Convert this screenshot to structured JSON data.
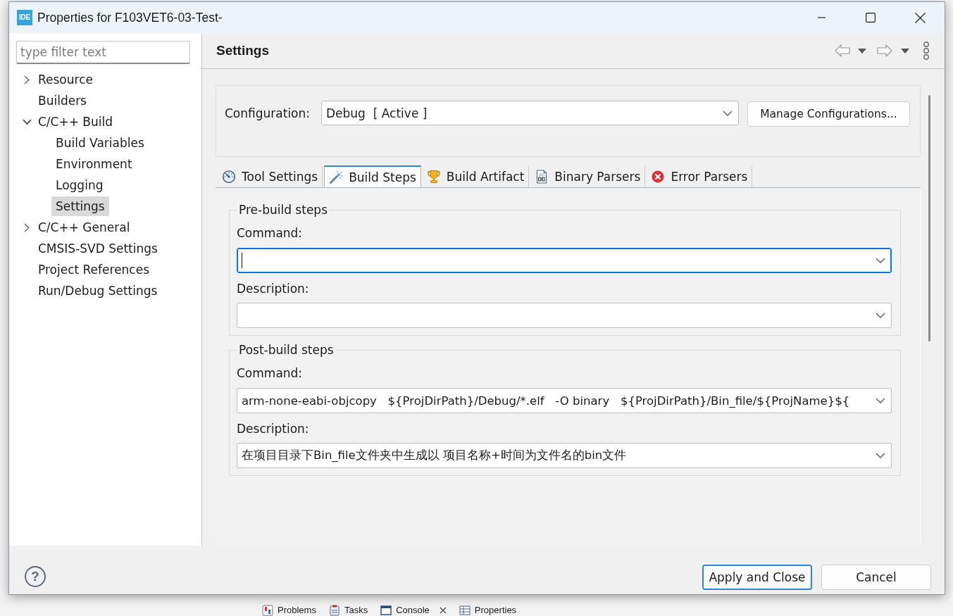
{
  "window": {
    "app_icon": "IDE",
    "title": "Properties for F103VET6-03-Test-"
  },
  "filter": {
    "placeholder": "type filter text"
  },
  "tree": [
    {
      "label": "Resource",
      "expanded": false,
      "selected": false
    },
    {
      "label": "Builders",
      "selected": false
    },
    {
      "label": "C/C++ Build",
      "expanded": true,
      "selected": false,
      "children": [
        {
          "label": "Build Variables",
          "selected": false
        },
        {
          "label": "Environment",
          "selected": false
        },
        {
          "label": "Logging",
          "selected": false
        },
        {
          "label": "Settings",
          "selected": true
        }
      ]
    },
    {
      "label": "C/C++ General",
      "expanded": false,
      "selected": false
    },
    {
      "label": "CMSIS-SVD Settings",
      "selected": false
    },
    {
      "label": "Project References",
      "selected": false
    },
    {
      "label": "Run/Debug Settings",
      "selected": false
    }
  ],
  "page": {
    "title": "Settings"
  },
  "configuration": {
    "label": "Configuration:",
    "value": "Debug  [ Active ]",
    "button": "Manage Configurations..."
  },
  "tabs": [
    {
      "label": "Tool Settings",
      "kind": "gauge",
      "selected": false
    },
    {
      "label": "Build Steps",
      "kind": "wand",
      "selected": true
    },
    {
      "label": "Build Artifact",
      "kind": "trophy",
      "selected": false
    },
    {
      "label": "Binary Parsers",
      "kind": "binary",
      "selected": false
    },
    {
      "label": "Error Parsers",
      "kind": "error",
      "selected": false
    }
  ],
  "pre_build": {
    "title": "Pre-build steps",
    "command": {
      "label": "Command:",
      "focused": true
    },
    "description": {
      "label": "Description:",
      "focused": false
    }
  },
  "post_build": {
    "title": "Post-build steps",
    "command": {
      "label": "Command:",
      "value": "arm-none-eabi-objcopy   ${ProjDirPath}/Debug/*.elf   -O binary   ${ProjDirPath}/Bin_file/${ProjName}${",
      "focused": false
    },
    "description": {
      "label": "Description:",
      "value": "在项目目录下Bin_file文件夹中生成以 项目名称+时间为文件名的bin文件",
      "focused": false
    }
  },
  "footer": {
    "help": "?",
    "buttons": [
      {
        "label": "Apply and Close",
        "default": true
      },
      {
        "label": "Cancel",
        "default": false
      }
    ]
  },
  "background": {
    "view_tabs": [
      {
        "label": "Problems",
        "kind": "problems",
        "closable": false
      },
      {
        "label": "Tasks",
        "kind": "tasks",
        "closable": false
      },
      {
        "label": "Console",
        "kind": "console",
        "closable": true
      },
      {
        "label": "Properties",
        "kind": "properties",
        "closable": false
      }
    ]
  }
}
